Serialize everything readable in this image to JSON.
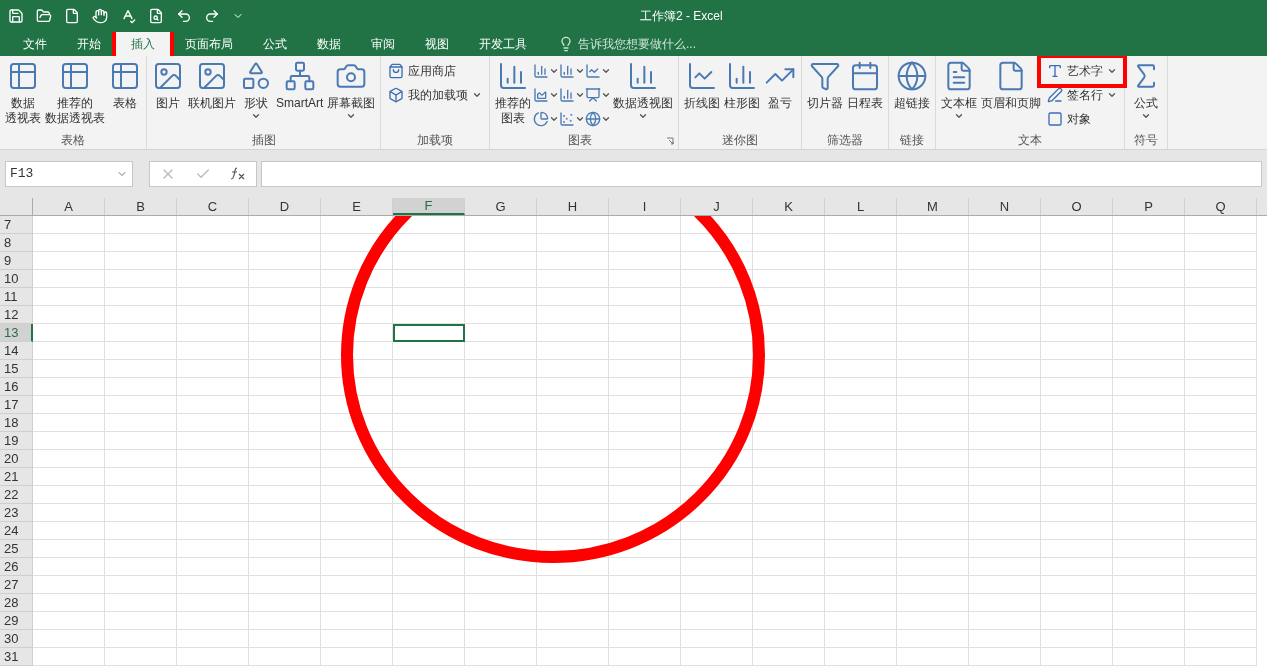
{
  "window": {
    "title": "工作簿2 - Excel"
  },
  "tabs": [
    {
      "label": "文件",
      "selected": false,
      "annotated": false
    },
    {
      "label": "开始",
      "selected": false,
      "annotated": false
    },
    {
      "label": "插入",
      "selected": true,
      "annotated": true
    },
    {
      "label": "页面布局",
      "selected": false,
      "annotated": false
    },
    {
      "label": "公式",
      "selected": false,
      "annotated": false
    },
    {
      "label": "数据",
      "selected": false,
      "annotated": false
    },
    {
      "label": "审阅",
      "selected": false,
      "annotated": false
    },
    {
      "label": "视图",
      "selected": false,
      "annotated": false
    },
    {
      "label": "开发工具",
      "selected": false,
      "annotated": false
    }
  ],
  "tell_me": {
    "placeholder": "告诉我您想要做什么..."
  },
  "ribbon": {
    "groups": [
      {
        "label": "表格",
        "items": [
          {
            "kind": "large",
            "label": [
              "数据",
              "透视表"
            ],
            "dropdown": false
          },
          {
            "kind": "large",
            "label": [
              "推荐的",
              "数据透视表"
            ],
            "dropdown": false
          },
          {
            "kind": "large",
            "label": "表格",
            "dropdown": false
          }
        ]
      },
      {
        "label": "插图",
        "items": [
          {
            "kind": "large",
            "label": "图片",
            "dropdown": false
          },
          {
            "kind": "large",
            "label": "联机图片",
            "dropdown": false
          },
          {
            "kind": "large",
            "label": "形状",
            "dropdown": true
          },
          {
            "kind": "large",
            "label": "SmartArt",
            "dropdown": false
          },
          {
            "kind": "large",
            "label": "屏幕截图",
            "dropdown": true
          }
        ]
      },
      {
        "label": "加载项",
        "items": [
          {
            "kind": "stack",
            "children": [
              {
                "label": "应用商店",
                "dropdown": false,
                "annotated": false
              },
              {
                "label": "我的加载项",
                "dropdown": true,
                "annotated": false
              }
            ]
          }
        ]
      },
      {
        "label": "图表",
        "launcher": true,
        "items": [
          {
            "kind": "large",
            "label": [
              "推荐的",
              "图表"
            ],
            "dropdown": false
          },
          {
            "kind": "iconstack",
            "children": [
              {
                "dropdown": true
              },
              {
                "dropdown": true
              },
              {
                "dropdown": true
              }
            ]
          },
          {
            "kind": "iconstack",
            "children": [
              {
                "dropdown": true
              },
              {
                "dropdown": true
              },
              {
                "dropdown": true
              }
            ]
          },
          {
            "kind": "iconstack",
            "children": [
              {
                "dropdown": true
              },
              {
                "dropdown": true
              },
              {
                "dropdown": true
              }
            ]
          },
          {
            "kind": "large",
            "label": "数据透视图",
            "dropdown": true
          }
        ]
      },
      {
        "label": "迷你图",
        "items": [
          {
            "kind": "large",
            "label": "折线图",
            "dropdown": false
          },
          {
            "kind": "large",
            "label": "柱形图",
            "dropdown": false
          },
          {
            "kind": "large",
            "label": "盈亏",
            "dropdown": false
          }
        ]
      },
      {
        "label": "筛选器",
        "items": [
          {
            "kind": "large",
            "label": "切片器",
            "dropdown": false
          },
          {
            "kind": "large",
            "label": "日程表",
            "dropdown": false
          }
        ]
      },
      {
        "label": "链接",
        "items": [
          {
            "kind": "large",
            "label": "超链接",
            "dropdown": false
          }
        ]
      },
      {
        "label": "文本",
        "items": [
          {
            "kind": "large",
            "label": "文本框",
            "dropdown": true
          },
          {
            "kind": "large",
            "label": "页眉和页脚",
            "dropdown": false
          },
          {
            "kind": "stack",
            "children": [
              {
                "label": "艺术字",
                "dropdown": true,
                "annotated": true
              },
              {
                "label": "签名行",
                "dropdown": true,
                "annotated": false
              },
              {
                "label": "对象",
                "dropdown": false,
                "annotated": false
              }
            ]
          }
        ]
      },
      {
        "label": "符号",
        "items": [
          {
            "kind": "large",
            "label": "公式",
            "dropdown": true
          }
        ]
      }
    ]
  },
  "name_box": {
    "value": "F13"
  },
  "columns": [
    {
      "label": "A",
      "selected": false
    },
    {
      "label": "B",
      "selected": false
    },
    {
      "label": "C",
      "selected": false
    },
    {
      "label": "D",
      "selected": false
    },
    {
      "label": "E",
      "selected": false
    },
    {
      "label": "F",
      "selected": true
    },
    {
      "label": "G",
      "selected": false
    },
    {
      "label": "H",
      "selected": false
    },
    {
      "label": "I",
      "selected": false
    },
    {
      "label": "J",
      "selected": false
    },
    {
      "label": "K",
      "selected": false
    },
    {
      "label": "L",
      "selected": false
    },
    {
      "label": "M",
      "selected": false
    },
    {
      "label": "N",
      "selected": false
    },
    {
      "label": "O",
      "selected": false
    },
    {
      "label": "P",
      "selected": false
    },
    {
      "label": "Q",
      "selected": false
    }
  ],
  "rows": [
    {
      "label": "7",
      "selected": false
    },
    {
      "label": "8",
      "selected": false
    },
    {
      "label": "9",
      "selected": false
    },
    {
      "label": "10",
      "selected": false
    },
    {
      "label": "11",
      "selected": false
    },
    {
      "label": "12",
      "selected": false
    },
    {
      "label": "13",
      "selected": true
    },
    {
      "label": "14",
      "selected": false
    },
    {
      "label": "15",
      "selected": false
    },
    {
      "label": "16",
      "selected": false
    },
    {
      "label": "17",
      "selected": false
    },
    {
      "label": "18",
      "selected": false
    },
    {
      "label": "19",
      "selected": false
    },
    {
      "label": "20",
      "selected": false
    },
    {
      "label": "21",
      "selected": false
    },
    {
      "label": "22",
      "selected": false
    },
    {
      "label": "23",
      "selected": false
    },
    {
      "label": "24",
      "selected": false
    },
    {
      "label": "25",
      "selected": false
    },
    {
      "label": "26",
      "selected": false
    },
    {
      "label": "27",
      "selected": false
    },
    {
      "label": "28",
      "selected": false
    },
    {
      "label": "29",
      "selected": false
    },
    {
      "label": "30",
      "selected": false
    },
    {
      "label": "31",
      "selected": false
    }
  ]
}
